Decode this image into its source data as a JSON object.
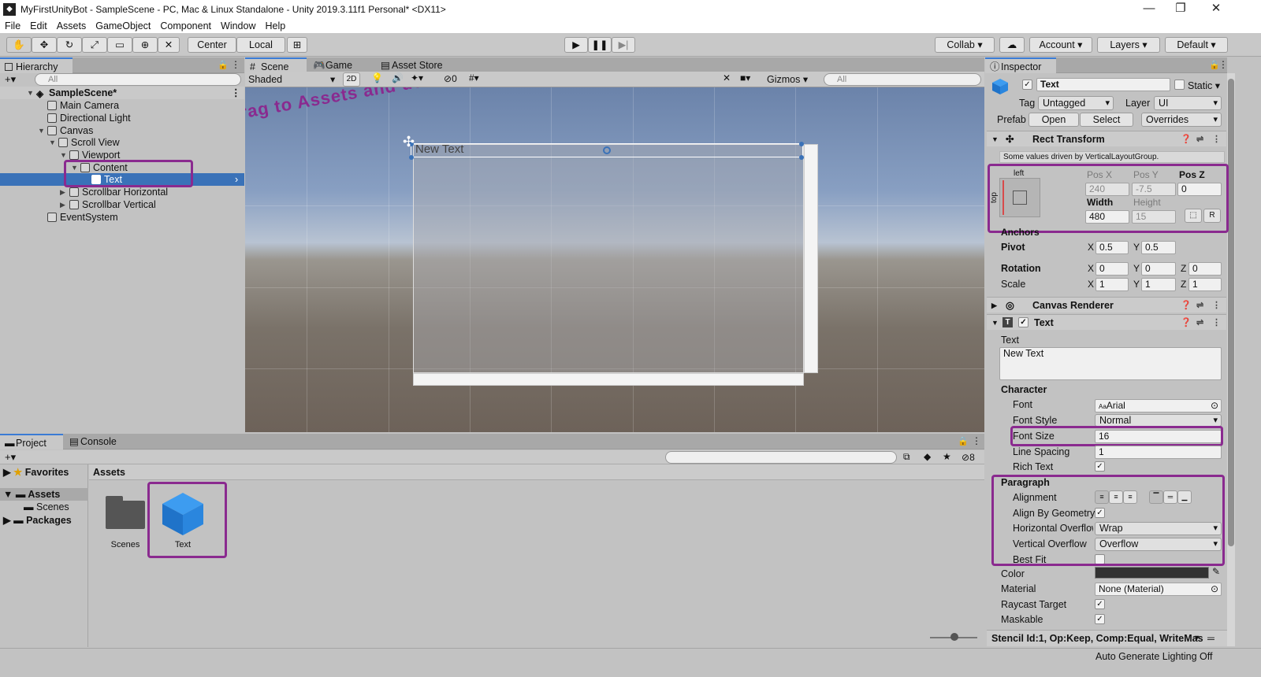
{
  "window": {
    "title": "MyFirstUnityBot - SampleScene - PC, Mac & Linux Standalone - Unity 2019.3.11f1 Personal* <DX11>",
    "minimize": "—",
    "maximize": "❐",
    "close": "✕"
  },
  "menu": [
    "File",
    "Edit",
    "Assets",
    "GameObject",
    "Component",
    "Window",
    "Help"
  ],
  "toolbar": {
    "center": "Center",
    "local": "Local",
    "collab": "Collab",
    "account": "Account",
    "layers": "Layers",
    "layout": "Default"
  },
  "hierarchy": {
    "tab": "Hierarchy",
    "search_placeholder": "All",
    "scene": "SampleScene*",
    "items": [
      "Main Camera",
      "Directional Light",
      "Canvas",
      "Scroll View",
      "Viewport",
      "Content",
      "Text",
      "Scrollbar Horizontal",
      "Scrollbar Vertical",
      "EventSystem"
    ]
  },
  "scene": {
    "tabs": [
      "Scene",
      "Game",
      "Asset Store"
    ],
    "shading": "Shaded",
    "mode_2d": "2D",
    "hidden_count": "0",
    "gizmos": "Gizmos",
    "search_placeholder": "All",
    "canvas_text": "New Text",
    "annotation": "<- Drag to Assets and delete"
  },
  "project": {
    "tabs": [
      "Project",
      "Console"
    ],
    "favorites": "Favorites",
    "assets": "Assets",
    "scenes": "Scenes",
    "packages": "Packages",
    "breadcrumb": "Assets",
    "hidden_count": "8",
    "items": [
      {
        "name": "Scenes",
        "type": "folder"
      },
      {
        "name": "Text",
        "type": "prefab"
      }
    ]
  },
  "inspector": {
    "tab": "Inspector",
    "object_name": "Text",
    "static_label": "Static",
    "tag_label": "Tag",
    "tag_value": "Untagged",
    "layer_label": "Layer",
    "layer_value": "UI",
    "prefab_label": "Prefab",
    "open": "Open",
    "select": "Select",
    "overrides": "Overrides",
    "rect_transform": {
      "title": "Rect Transform",
      "notice": "Some values driven by VerticalLayoutGroup.",
      "anchor_h": "left",
      "anchor_v": "top",
      "posx_label": "Pos X",
      "posy_label": "Pos Y",
      "posz_label": "Pos Z",
      "posx": "240",
      "posy": "-7.5",
      "posz": "0",
      "width_label": "Width",
      "height_label": "Height",
      "width": "480",
      "height": "15",
      "r_btn": "R",
      "anchors": "Anchors",
      "pivot": "Pivot",
      "pivot_x": "0.5",
      "pivot_y": "0.5",
      "rotation": "Rotation",
      "rot_x": "0",
      "rot_y": "0",
      "rot_z": "0",
      "scale": "Scale",
      "scale_x": "1",
      "scale_y": "1",
      "scale_z": "1"
    },
    "canvas_renderer": "Canvas Renderer",
    "text_component": {
      "title": "Text",
      "text_label": "Text",
      "text_value": "New Text",
      "character": "Character",
      "font_label": "Font",
      "font_value": "Arial",
      "font_style_label": "Font Style",
      "font_style_value": "Normal",
      "font_size_label": "Font Size",
      "font_size_value": "16",
      "line_spacing_label": "Line Spacing",
      "line_spacing_value": "1",
      "rich_text_label": "Rich Text",
      "paragraph": "Paragraph",
      "alignment_label": "Alignment",
      "align_geom_label": "Align By Geometry",
      "horiz_label": "Horizontal Overflow",
      "horiz_value": "Wrap",
      "vert_label": "Vertical Overflow",
      "vert_value": "Overflow",
      "best_fit_label": "Best Fit",
      "color_label": "Color",
      "material_label": "Material",
      "material_value": "None (Material)",
      "raycast_label": "Raycast Target",
      "maskable_label": "Maskable"
    },
    "stencil": "Stencil Id:1, Op:Keep, Comp:Equal, WriteMas"
  },
  "status": {
    "lighting": "Auto Generate Lighting Off"
  },
  "colors": {
    "selection": "#3a72b8",
    "annotation": "#8a2a8f",
    "text_color_swatch": "#323232"
  }
}
